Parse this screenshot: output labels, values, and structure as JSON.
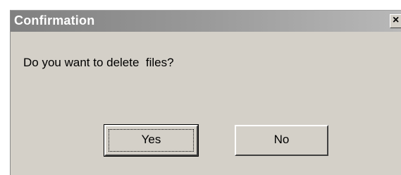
{
  "window": {
    "title": "Confirmation",
    "close_symbol": "×"
  },
  "message": "Do you want to delete  files?",
  "buttons": {
    "yes_label": "Yes",
    "no_label": "No"
  },
  "icons": {
    "close": "close-icon"
  },
  "colors": {
    "dialog_face": "#d4d0c8",
    "titlebar_start": "#808080",
    "titlebar_end": "#b8b8b8",
    "title_text": "#ffffff"
  }
}
